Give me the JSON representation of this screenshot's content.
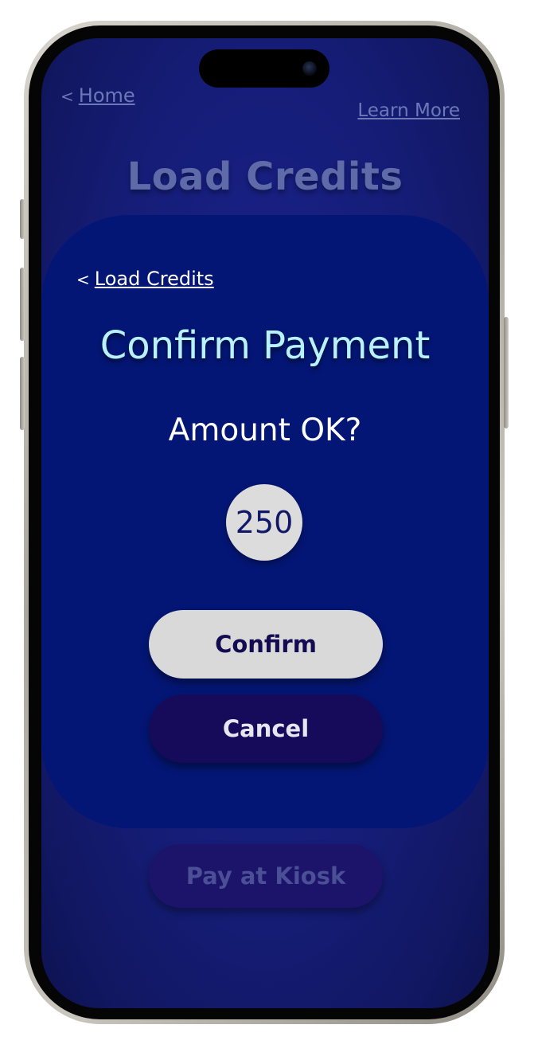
{
  "nav": {
    "back_chevron": "<",
    "home_label": "Home",
    "learn_more_label": "Learn More"
  },
  "page": {
    "title": "Load Credits",
    "kiosk_button_label": "Pay at Kiosk"
  },
  "modal": {
    "back_chevron": "<",
    "back_label": "Load Credits",
    "title": "Confirm Payment",
    "question": "Amount OK?",
    "amount": "250",
    "confirm_label": "Confirm",
    "cancel_label": "Cancel"
  },
  "colors": {
    "screen_background": "#151d78",
    "modal_background": "#041675",
    "modal_title": "#b8f2ff",
    "confirm_button": "#d9d9d9",
    "cancel_button": "#150b5a",
    "muted_text": "#6d78b8"
  }
}
